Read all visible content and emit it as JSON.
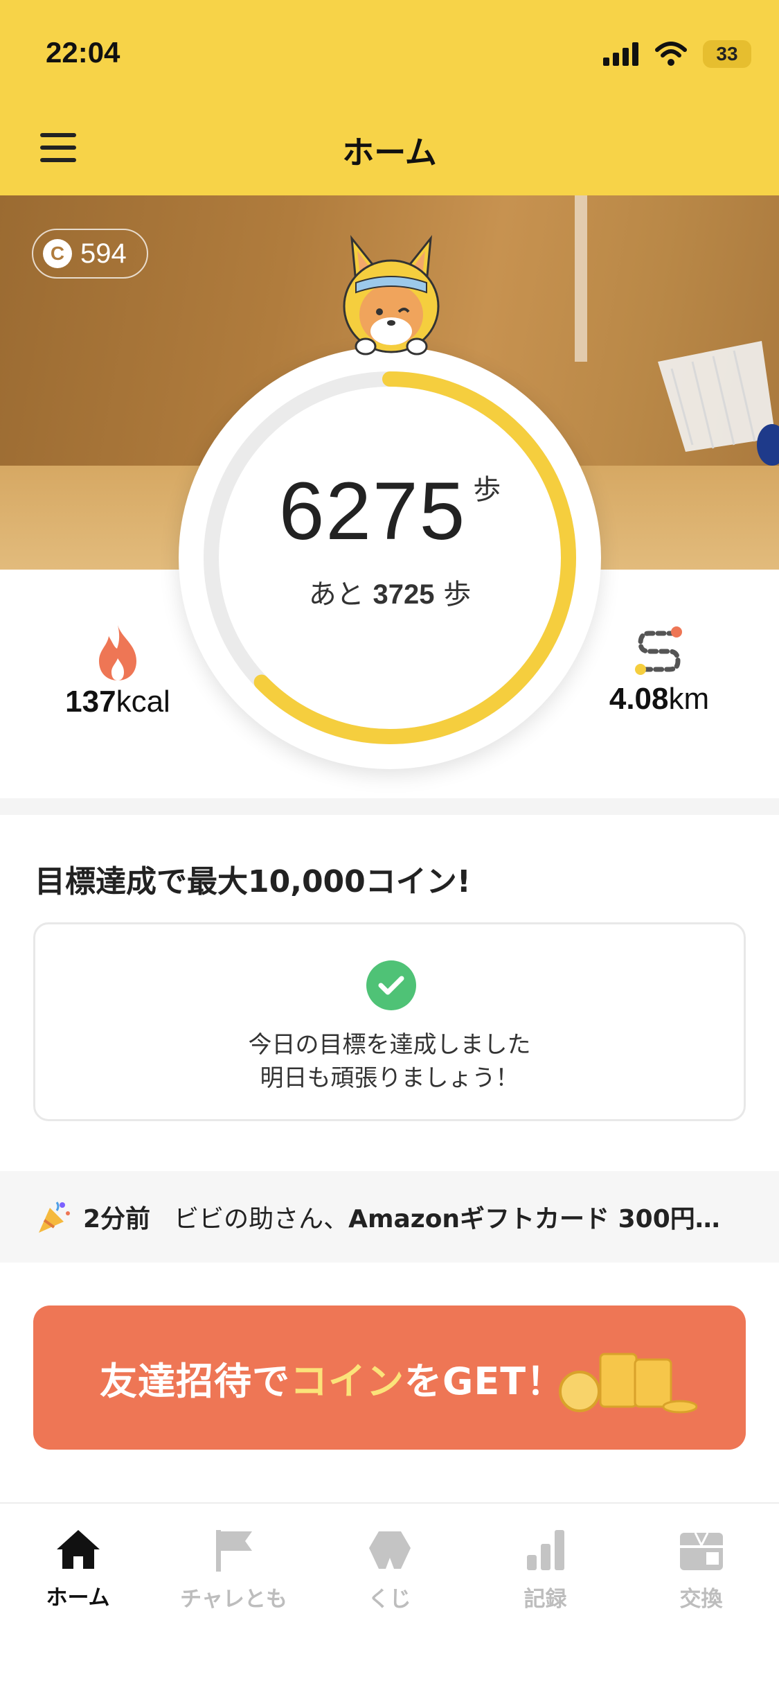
{
  "status_bar": {
    "time": "22:04",
    "battery": "33"
  },
  "header": {
    "title": "ホーム"
  },
  "hero": {
    "coins": "594"
  },
  "steps": {
    "count": "6275",
    "unit": "歩",
    "remaining_prefix": "あと",
    "remaining": "3725",
    "remaining_unit": "歩",
    "progress": 0.6275
  },
  "stats": {
    "kcal_value": "137",
    "kcal_unit": "kcal",
    "distance_value": "4.08",
    "distance_unit": "km"
  },
  "goal": {
    "title": "目標達成で最大10,000コイン!",
    "line1": "今日の目標を達成しました",
    "line2": "明日も頑張りましょう！"
  },
  "ticker": {
    "time": "2分前",
    "prefix": "ビビの助さん、",
    "bold": "Amazonギフトカード 300円…"
  },
  "invite": {
    "text_a": "友達招待で",
    "text_b": "コイン",
    "text_c": "をGET！"
  },
  "tabs": [
    {
      "label": "ホーム",
      "icon": "home-icon"
    },
    {
      "label": "チャレとも",
      "icon": "flag-icon"
    },
    {
      "label": "くじ",
      "icon": "lottery-icon"
    },
    {
      "label": "記録",
      "icon": "bar-chart-icon"
    },
    {
      "label": "交換",
      "icon": "gift-icon"
    }
  ],
  "colors": {
    "header": "#F7D348",
    "ring": "#F5CE3E",
    "accent_orange": "#EE7655",
    "check_green": "#4FC276"
  }
}
